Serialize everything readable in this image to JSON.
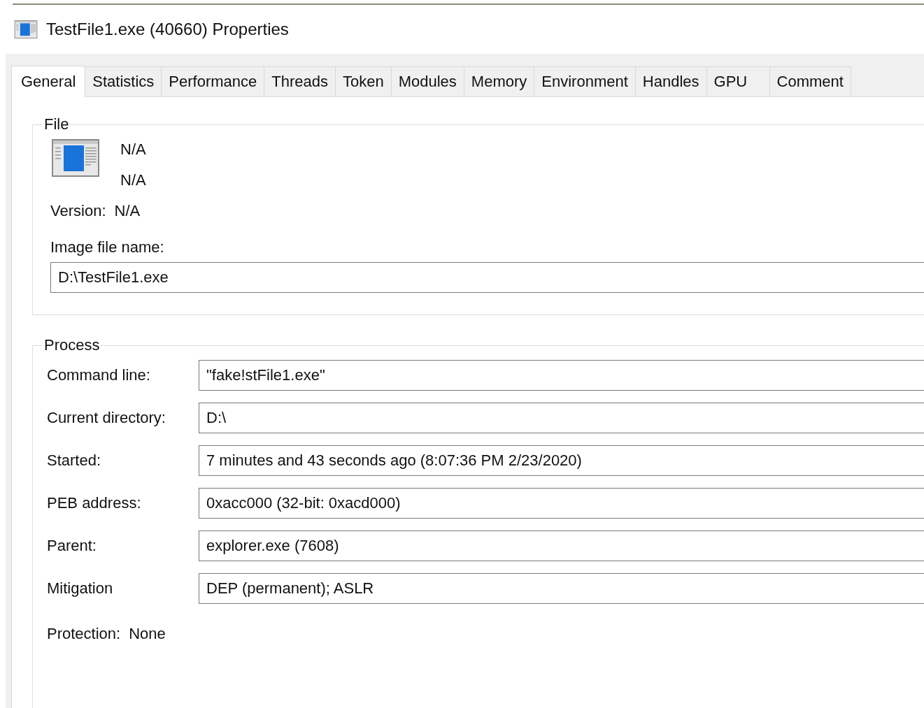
{
  "window": {
    "title": "TestFile1.exe (40660) Properties"
  },
  "tabs": [
    {
      "label": "General",
      "selected": true
    },
    {
      "label": "Statistics",
      "selected": false
    },
    {
      "label": "Performance",
      "selected": false
    },
    {
      "label": "Threads",
      "selected": false
    },
    {
      "label": "Token",
      "selected": false
    },
    {
      "label": "Modules",
      "selected": false
    },
    {
      "label": "Memory",
      "selected": false
    },
    {
      "label": "Environment",
      "selected": false
    },
    {
      "label": "Handles",
      "selected": false
    },
    {
      "label": "GPU",
      "selected": false
    },
    {
      "label": "Comment",
      "selected": false
    }
  ],
  "file": {
    "title": "File",
    "info_lines": [
      "N/A",
      "N/A"
    ],
    "version": {
      "label": "Version:",
      "value": "N/A"
    },
    "image_file_name": {
      "label": "Image file name:",
      "value": "D:\\TestFile1.exe"
    }
  },
  "process": {
    "title": "Process",
    "fields": [
      {
        "label": "Command line:",
        "value": "\"fake!stFile1.exe\""
      },
      {
        "label": "Current directory:",
        "value": "D:\\"
      },
      {
        "label": "Started:",
        "value": "7 minutes and 43 seconds ago (8:07:36 PM 2/23/2020)"
      },
      {
        "label": "PEB address:",
        "value": "0xacc000 (32-bit: 0xacd000)"
      },
      {
        "label": "Parent:",
        "value": "explorer.exe (7608)"
      },
      {
        "label": "Mitigation",
        "value": "DEP (permanent); ASLR"
      }
    ],
    "protection": {
      "label": "Protection:",
      "value": "None"
    }
  }
}
